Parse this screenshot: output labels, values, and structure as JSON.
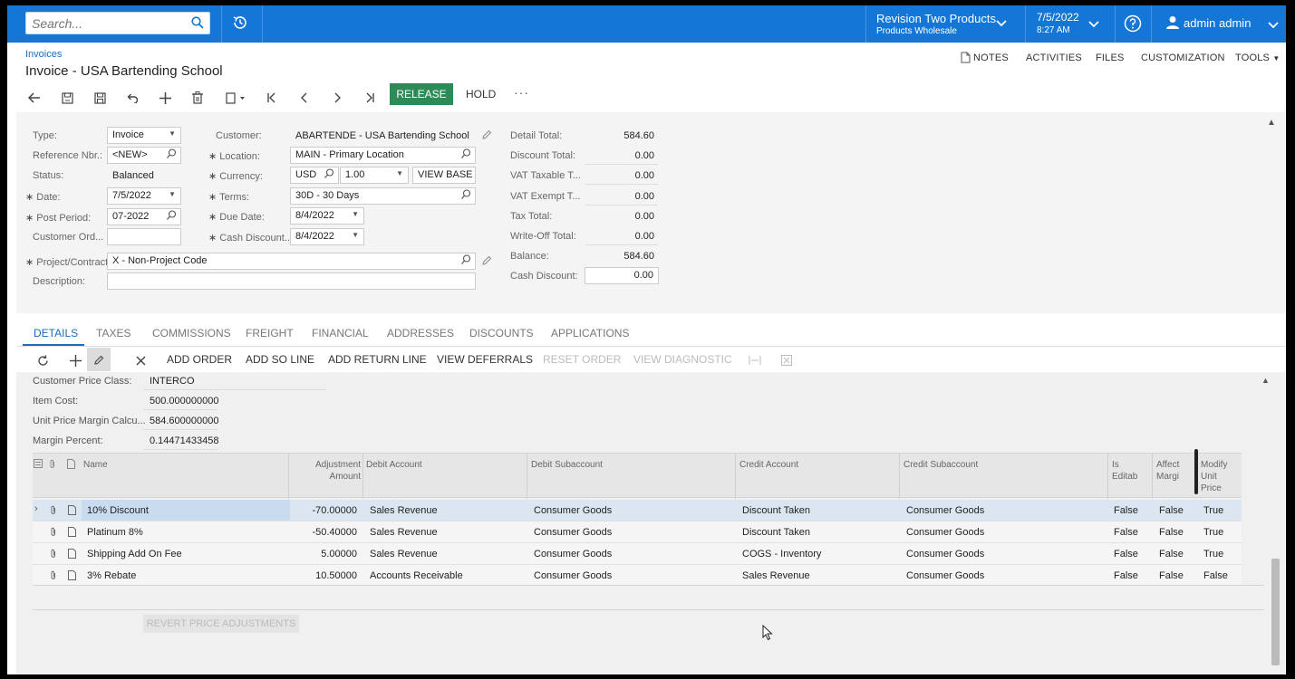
{
  "search": {
    "placeholder": "Search..."
  },
  "header": {
    "tenant_name": "Revision Two Products",
    "tenant_branch": "Products Wholesale",
    "date": "7/5/2022",
    "time": "8:27 AM",
    "user": "admin admin"
  },
  "breadcrumb": "Invoices",
  "page_title": "Invoice - USA Bartending School",
  "toplinks": [
    "NOTES",
    "ACTIVITIES",
    "FILES",
    "CUSTOMIZATION",
    "TOOLS"
  ],
  "toolbar": {
    "release": "RELEASE",
    "hold": "HOLD",
    "more": "···"
  },
  "form": {
    "type_label": "Type:",
    "type_value": "Invoice",
    "ref_label": "Reference Nbr.:",
    "ref_value": "<NEW>",
    "status_label": "Status:",
    "status_value": "Balanced",
    "date_label": "Date:",
    "date_value": "7/5/2022",
    "post_period_label": "Post Period:",
    "post_period_value": "07-2022",
    "customer_ord_label": "Customer Ord...",
    "customer_ord_value": "",
    "project_label": "Project/Contract:",
    "project_value": "X - Non-Project Code",
    "description_label": "Description:",
    "description_value": "",
    "customer_label": "Customer:",
    "customer_value": "ABARTENDE - USA Bartending School",
    "location_label": "Location:",
    "location_value": "MAIN - Primary Location",
    "currency_label": "Currency:",
    "currency_value": "USD",
    "rate_value": "1.00",
    "view_base": "VIEW BASE",
    "terms_label": "Terms:",
    "terms_value": "30D - 30 Days",
    "due_date_label": "Due Date:",
    "due_date_value": "8/4/2022",
    "cash_discount_label": "Cash Discount...",
    "cash_discount_value": "8/4/2022",
    "totals": [
      {
        "label": "Detail Total:",
        "value": "584.60"
      },
      {
        "label": "Discount Total:",
        "value": "0.00"
      },
      {
        "label": "VAT Taxable T...",
        "value": "0.00"
      },
      {
        "label": "VAT Exempt T...",
        "value": "0.00"
      },
      {
        "label": "Tax Total:",
        "value": "0.00"
      },
      {
        "label": "Write-Off Total:",
        "value": "0.00"
      },
      {
        "label": "Balance:",
        "value": "584.60"
      },
      {
        "label": "Cash Discount:",
        "value": "0.00"
      }
    ]
  },
  "tabs": [
    "DETAILS",
    "TAXES",
    "COMMISSIONS",
    "FREIGHT",
    "FINANCIAL",
    "ADDRESSES",
    "DISCOUNTS",
    "APPLICATIONS"
  ],
  "grid_toolbar": {
    "add_order": "ADD ORDER",
    "add_so_line": "ADD SO LINE",
    "add_return_line": "ADD RETURN LINE",
    "view_deferrals": "VIEW DEFERRALS",
    "reset_order": "RESET ORDER",
    "view_diagnostic": "VIEW DIAGNOSTIC"
  },
  "pricing": [
    {
      "label": "Customer Price Class:",
      "value": "INTERCO"
    },
    {
      "label": "Item Cost:",
      "value": "500.000000000"
    },
    {
      "label": "Unit Price Margin Calcu...",
      "value": "584.600000000"
    },
    {
      "label": "Margin Percent:",
      "value": "0.144714334580"
    }
  ],
  "grid": {
    "headers": {
      "name": "Name",
      "adj_amount_1": "Adjustment",
      "adj_amount_2": "Amount",
      "debit_account": "Debit Account",
      "debit_sub": "Debit Subaccount",
      "credit_account": "Credit Account",
      "credit_sub": "Credit Subaccount",
      "is_editable_1": "Is",
      "is_editable_2": "Editab",
      "affects_1": "Affect",
      "affects_2": "Margi",
      "modify_1": "Modify",
      "modify_2": "Unit",
      "modify_3": "Price"
    },
    "rows": [
      {
        "name": "10% Discount",
        "amount": "-70.00000",
        "debit_account": "Sales Revenue",
        "debit_sub": "Consumer Goods",
        "credit_account": "Discount Taken",
        "credit_sub": "Consumer Goods",
        "is_editable": "False",
        "affects_margin": "False",
        "modify_price": "True"
      },
      {
        "name": "Platinum 8%",
        "amount": "-50.40000",
        "debit_account": "Sales Revenue",
        "debit_sub": "Consumer Goods",
        "credit_account": "Discount Taken",
        "credit_sub": "Consumer Goods",
        "is_editable": "False",
        "affects_margin": "False",
        "modify_price": "True"
      },
      {
        "name": "Shipping Add On Fee",
        "amount": "5.00000",
        "debit_account": "Sales Revenue",
        "debit_sub": "Consumer Goods",
        "credit_account": "COGS - Inventory",
        "credit_sub": "Consumer Goods",
        "is_editable": "False",
        "affects_margin": "False",
        "modify_price": "True"
      },
      {
        "name": "3% Rebate",
        "amount": "10.50000",
        "debit_account": "Accounts Receivable",
        "debit_sub": "Consumer Goods",
        "credit_account": "Sales Revenue",
        "credit_sub": "Consumer Goods",
        "is_editable": "False",
        "affects_margin": "False",
        "modify_price": "False"
      }
    ]
  },
  "revert_button": "REVERT PRICE ADJUSTMENTS",
  "colors": {
    "topbar": "#1476d6",
    "release": "#2e8b57",
    "link": "#1a6bbf"
  }
}
